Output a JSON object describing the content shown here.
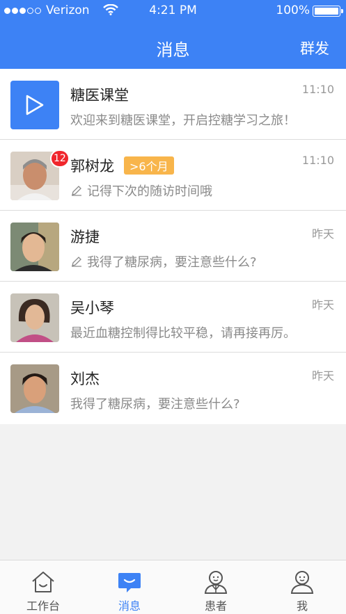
{
  "status_bar": {
    "carrier": "Verizon",
    "time": "4:21 PM",
    "battery": "100%"
  },
  "nav": {
    "title": "消息",
    "action": "群发"
  },
  "messages": [
    {
      "name": "糖医课堂",
      "time": "11:10",
      "preview": "欢迎来到糖医课堂，开启控糖学习之旅！",
      "avatar": "play-icon"
    },
    {
      "name": "郭树龙",
      "tag": ">6个月",
      "badge": "12",
      "time": "11:10",
      "preview": "记得下次的随访时间哦",
      "draft": true
    },
    {
      "name": "游捷",
      "time": "昨天",
      "preview": "我得了糖尿病，要注意些什么?",
      "draft": true
    },
    {
      "name": "吴小琴",
      "time": "昨天",
      "preview": "最近血糖控制得比较平稳，请再接再厉。"
    },
    {
      "name": "刘杰",
      "time": "昨天",
      "preview": "我得了糖尿病，要注意些什么?"
    }
  ],
  "tabs": [
    {
      "label": "工作台",
      "icon": "home-icon"
    },
    {
      "label": "消息",
      "icon": "chat-icon",
      "active": true
    },
    {
      "label": "患者",
      "icon": "patient-icon"
    },
    {
      "label": "我",
      "icon": "user-icon"
    }
  ],
  "colors": {
    "primary": "#3d82f5",
    "badge": "#f0262c",
    "tag": "#f8b54b"
  }
}
